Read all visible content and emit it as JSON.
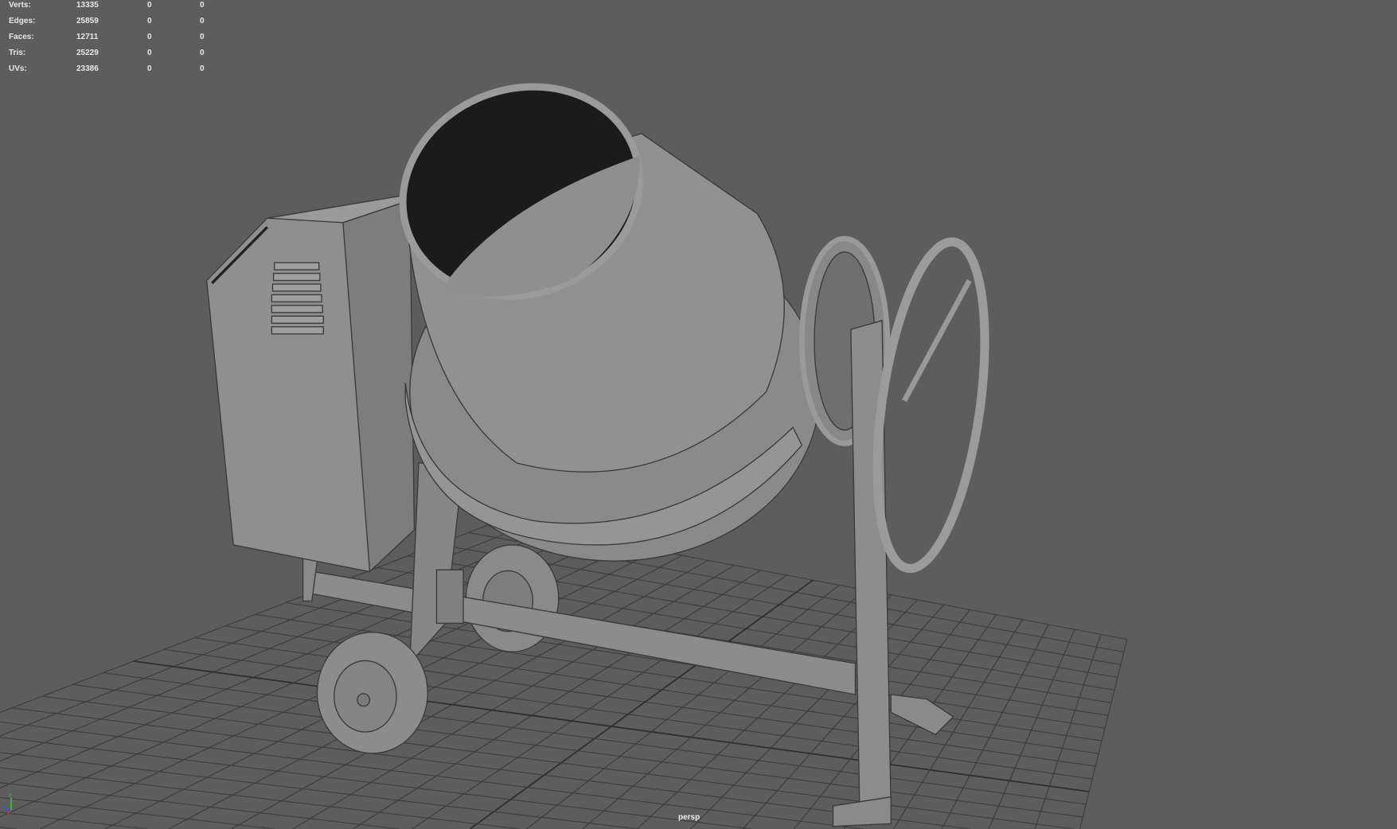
{
  "hud": {
    "rows": [
      {
        "label": "Verts:",
        "v1": "13335",
        "v2": "0",
        "v3": "0"
      },
      {
        "label": "Edges:",
        "v1": "25859",
        "v2": "0",
        "v3": "0"
      },
      {
        "label": "Faces:",
        "v1": "12711",
        "v2": "0",
        "v3": "0"
      },
      {
        "label": "Tris:",
        "v1": "25229",
        "v2": "0",
        "v3": "0"
      },
      {
        "label": "UVs:",
        "v1": "23386",
        "v2": "0",
        "v3": "0"
      }
    ]
  },
  "camera_label": "persp",
  "axis": {
    "y": "Y",
    "z": "Z"
  },
  "colors": {
    "background": "#5d5d5d",
    "grid": "#3c3c3c",
    "model": "#8e8e8e"
  }
}
